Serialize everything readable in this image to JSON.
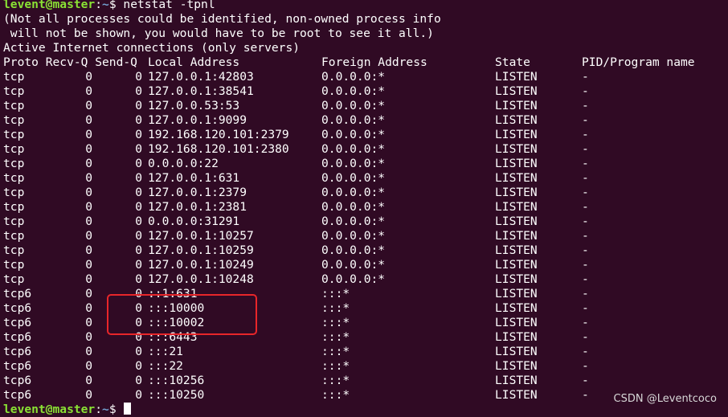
{
  "prompt": {
    "user": "levent@master",
    "sep": ":",
    "path": "~",
    "symbol": "$ "
  },
  "command": "netstat -tpnl",
  "messages": [
    "(Not all processes could be identified, non-owned process info",
    " will not be shown, you would have to be root to see it all.)",
    "Active Internet connections (only servers)"
  ],
  "headers": [
    "Proto Recv-Q Send-Q",
    "Local Address",
    "Foreign Address",
    "State",
    "PID/Program name"
  ],
  "rows": [
    [
      "tcp",
      "0",
      "0",
      "127.0.0.1:42803",
      "0.0.0.0:*",
      "LISTEN",
      "-"
    ],
    [
      "tcp",
      "0",
      "0",
      "127.0.0.1:38541",
      "0.0.0.0:*",
      "LISTEN",
      "-"
    ],
    [
      "tcp",
      "0",
      "0",
      "127.0.0.53:53",
      "0.0.0.0:*",
      "LISTEN",
      "-"
    ],
    [
      "tcp",
      "0",
      "0",
      "127.0.0.1:9099",
      "0.0.0.0:*",
      "LISTEN",
      "-"
    ],
    [
      "tcp",
      "0",
      "0",
      "192.168.120.101:2379",
      "0.0.0.0:*",
      "LISTEN",
      "-"
    ],
    [
      "tcp",
      "0",
      "0",
      "192.168.120.101:2380",
      "0.0.0.0:*",
      "LISTEN",
      "-"
    ],
    [
      "tcp",
      "0",
      "0",
      "0.0.0.0:22",
      "0.0.0.0:*",
      "LISTEN",
      "-"
    ],
    [
      "tcp",
      "0",
      "0",
      "127.0.0.1:631",
      "0.0.0.0:*",
      "LISTEN",
      "-"
    ],
    [
      "tcp",
      "0",
      "0",
      "127.0.0.1:2379",
      "0.0.0.0:*",
      "LISTEN",
      "-"
    ],
    [
      "tcp",
      "0",
      "0",
      "127.0.0.1:2381",
      "0.0.0.0:*",
      "LISTEN",
      "-"
    ],
    [
      "tcp",
      "0",
      "0",
      "0.0.0.0:31291",
      "0.0.0.0:*",
      "LISTEN",
      "-"
    ],
    [
      "tcp",
      "0",
      "0",
      "127.0.0.1:10257",
      "0.0.0.0:*",
      "LISTEN",
      "-"
    ],
    [
      "tcp",
      "0",
      "0",
      "127.0.0.1:10259",
      "0.0.0.0:*",
      "LISTEN",
      "-"
    ],
    [
      "tcp",
      "0",
      "0",
      "127.0.0.1:10249",
      "0.0.0.0:*",
      "LISTEN",
      "-"
    ],
    [
      "tcp",
      "0",
      "0",
      "127.0.0.1:10248",
      "0.0.0.0:*",
      "LISTEN",
      "-"
    ],
    [
      "tcp6",
      "0",
      "0",
      "::1:631",
      ":::*",
      "LISTEN",
      "-"
    ],
    [
      "tcp6",
      "0",
      "0",
      ":::10000",
      ":::*",
      "LISTEN",
      "-"
    ],
    [
      "tcp6",
      "0",
      "0",
      ":::10002",
      ":::*",
      "LISTEN",
      "-"
    ],
    [
      "tcp6",
      "0",
      "0",
      ":::6443",
      ":::*",
      "LISTEN",
      "-"
    ],
    [
      "tcp6",
      "0",
      "0",
      ":::21",
      ":::*",
      "LISTEN",
      "-"
    ],
    [
      "tcp6",
      "0",
      "0",
      ":::22",
      ":::*",
      "LISTEN",
      "-"
    ],
    [
      "tcp6",
      "0",
      "0",
      ":::10256",
      ":::*",
      "LISTEN",
      "-"
    ],
    [
      "tcp6",
      "0",
      "0",
      ":::10250",
      ":::*",
      "LISTEN",
      "-"
    ]
  ],
  "watermark": "CSDN @Leventcoco",
  "colors": {
    "background": "#300a24",
    "user": "#8ae234",
    "path": "#729fcf",
    "highlight": "#e8262a"
  }
}
